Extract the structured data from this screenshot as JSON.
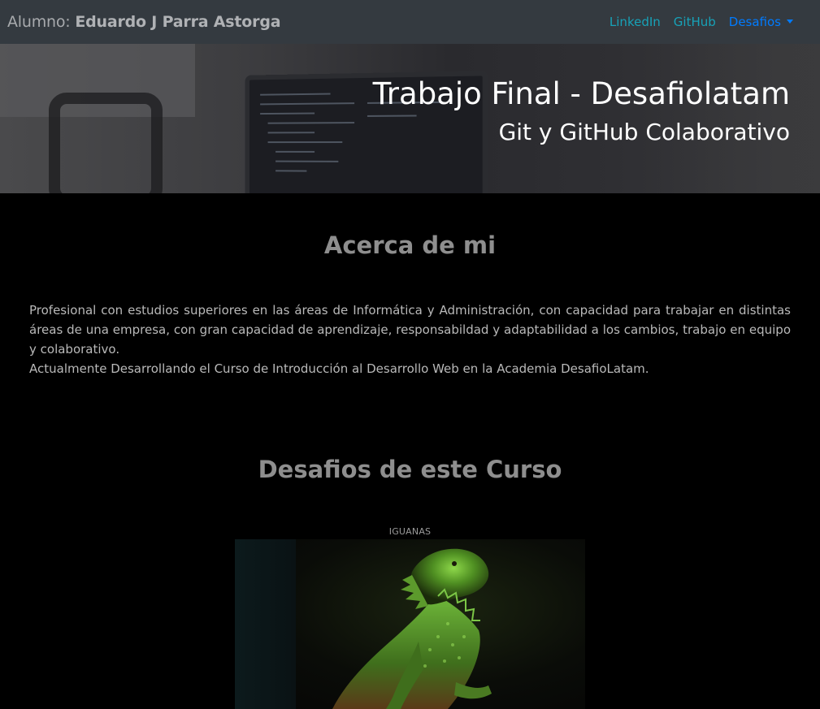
{
  "navbar": {
    "brand_prefix": "Alumno: ",
    "brand_name": "Eduardo J Parra Astorga",
    "links": [
      {
        "label": "LinkedIn"
      },
      {
        "label": "GitHub"
      },
      {
        "label": "Desafios"
      }
    ]
  },
  "hero": {
    "title": "Trabajo Final - Desafiolatam",
    "subtitle": "Git y GitHub Colaborativo"
  },
  "about": {
    "title": "Acerca de mi",
    "paragraph_1": "Profesional con estudios superiores en las áreas de Informática y Administración, con capacidad para trabajar en distintas áreas de una empresa, con gran capacidad de aprendizaje, responsabildad y adaptabilidad a los cambios, trabajo en equipo y colaborativo.",
    "paragraph_2": "Actualmente Desarrollando el Curso de Introducción al Desarrollo Web en la Academia DesafioLatam."
  },
  "challenges": {
    "title": "Desafios de este Curso",
    "cards": [
      {
        "label": "IGUANAS",
        "image": "iguana-photo"
      }
    ]
  },
  "colors": {
    "navbar_bg": "#343a40",
    "link_info": "#17a2b8",
    "link_primary": "#007bff",
    "page_bg": "#000000",
    "heading_gray": "#8e8e8e"
  }
}
